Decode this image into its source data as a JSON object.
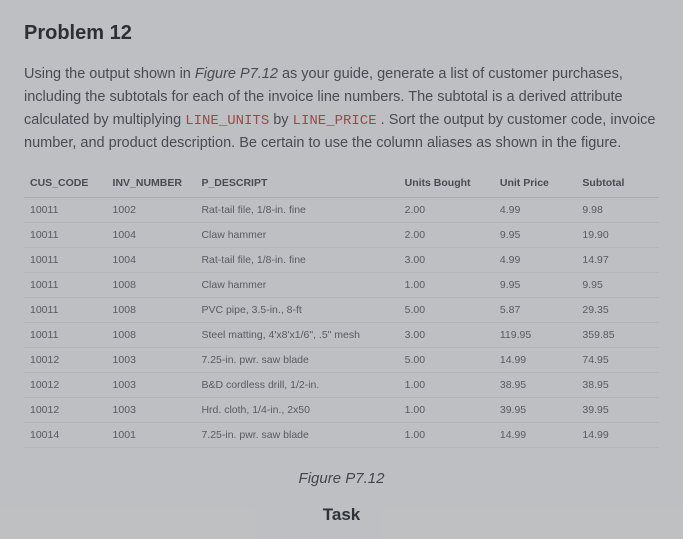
{
  "title": "Problem 12",
  "prompt": {
    "p1_a": "Using the output shown in ",
    "fig_ref": "Figure P7.12",
    "p1_b": " as your guide, generate a list of customer purchases, including the subtotals for each of the invoice line numbers. The subtotal is a derived attribute calculated by multiplying ",
    "code1": "LINE_UNITS",
    "p1_c": " by ",
    "code2": "LINE_PRICE",
    "p1_d": " . Sort the output by customer code, invoice number, and product description. Be certain to use the column aliases as shown in the figure."
  },
  "headers": {
    "cus": "CUS_CODE",
    "inv": "INV_NUMBER",
    "desc": "P_DESCRIPT",
    "units": "Units Bought",
    "price": "Unit Price",
    "sub": "Subtotal"
  },
  "rows": [
    {
      "cus": "10011",
      "inv": "1002",
      "desc": "Rat-tail file, 1/8-in. fine",
      "units": "2.00",
      "price": "4.99",
      "sub": "9.98"
    },
    {
      "cus": "10011",
      "inv": "1004",
      "desc": "Claw hammer",
      "units": "2.00",
      "price": "9.95",
      "sub": "19.90"
    },
    {
      "cus": "10011",
      "inv": "1004",
      "desc": "Rat-tail file, 1/8-in. fine",
      "units": "3.00",
      "price": "4.99",
      "sub": "14.97"
    },
    {
      "cus": "10011",
      "inv": "1008",
      "desc": "Claw hammer",
      "units": "1.00",
      "price": "9.95",
      "sub": "9.95"
    },
    {
      "cus": "10011",
      "inv": "1008",
      "desc": "PVC pipe, 3.5-in., 8-ft",
      "units": "5.00",
      "price": "5.87",
      "sub": "29.35"
    },
    {
      "cus": "10011",
      "inv": "1008",
      "desc": "Steel matting, 4'x8'x1/6\", .5\" mesh",
      "units": "3.00",
      "price": "119.95",
      "sub": "359.85"
    },
    {
      "cus": "10012",
      "inv": "1003",
      "desc": "7.25-in. pwr. saw blade",
      "units": "5.00",
      "price": "14.99",
      "sub": "74.95"
    },
    {
      "cus": "10012",
      "inv": "1003",
      "desc": "B&D cordless drill, 1/2-in.",
      "units": "1.00",
      "price": "38.95",
      "sub": "38.95"
    },
    {
      "cus": "10012",
      "inv": "1003",
      "desc": "Hrd. cloth, 1/4-in., 2x50",
      "units": "1.00",
      "price": "39.95",
      "sub": "39.95"
    },
    {
      "cus": "10014",
      "inv": "1001",
      "desc": "7.25-in. pwr. saw blade",
      "units": "1.00",
      "price": "14.99",
      "sub": "14.99"
    }
  ],
  "figure_caption": "Figure P7.12",
  "task_heading": "Task"
}
